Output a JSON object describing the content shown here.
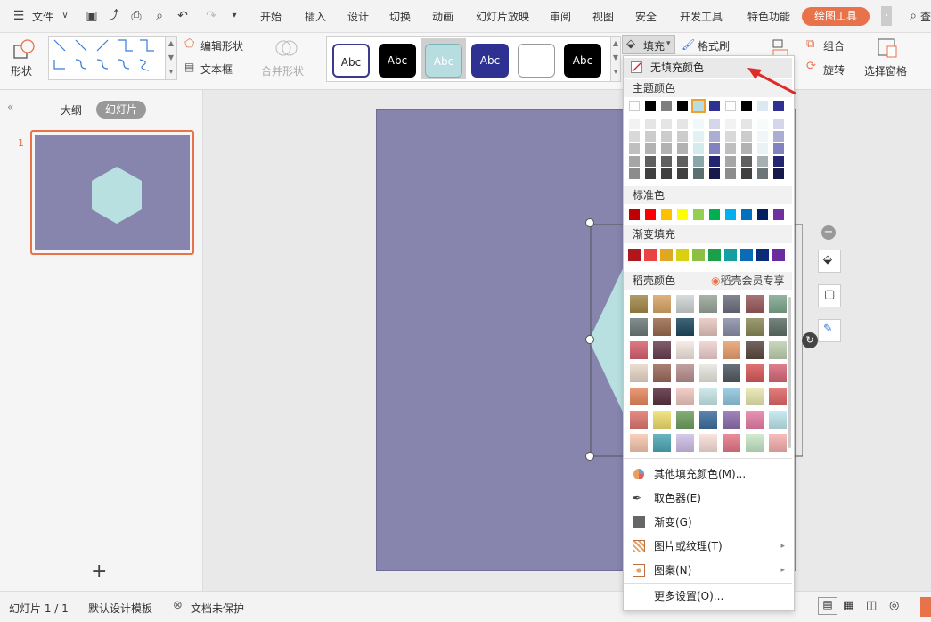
{
  "menu": {
    "file": "文件",
    "tabs": [
      "开始",
      "插入",
      "设计",
      "切换",
      "动画",
      "幻灯片放映",
      "审阅",
      "视图",
      "安全",
      "开发工具",
      "特色功能"
    ],
    "active_tab": "绘图工具",
    "search": "查"
  },
  "ribbon": {
    "shape": "形状",
    "edit_shape": "编辑形状",
    "textbox": "文本框",
    "merge_shape": "合并形状",
    "style_label": "Abc",
    "fill": "填充",
    "format_painter": "格式刷",
    "group": "组合",
    "rotate": "旋转",
    "selection_pane": "选择窗格"
  },
  "left_panel": {
    "outline_tab": "大纲",
    "slides_tab": "幻灯片",
    "slide_number": "1",
    "add": "+"
  },
  "status": {
    "slide_info": "幻灯片 1 / 1",
    "template": "默认设计模板",
    "protection": "文档未保护"
  },
  "fill_menu": {
    "no_fill": "无填充颜色",
    "theme_colors": "主题颜色",
    "standard_colors": "标准色",
    "gradient_fill": "渐变填充",
    "docer_colors": "稻壳颜色",
    "docer_member": "稻壳会员专享",
    "more_colors": "其他填充颜色(M)...",
    "eyedropper": "取色器(E)",
    "gradient": "渐变(G)",
    "picture_texture": "图片或纹理(T)",
    "pattern": "图案(N)",
    "more_settings": "更多设置(O)..."
  },
  "colors": {
    "accent": "#e8734a",
    "slide_bg": "#8784ae",
    "hexagon": "#b8e0e0",
    "theme_top": [
      "#ffffff",
      "#000000",
      "#7f7f7f",
      "#000000",
      "#b7dde0",
      "#2e3192",
      "#ffffff",
      "#000000",
      "#dce9f0",
      "#2e3192"
    ],
    "standard": [
      "#c00000",
      "#ff0000",
      "#ffc000",
      "#ffff00",
      "#92d050",
      "#00b050",
      "#00b0f0",
      "#0070c0",
      "#002060",
      "#7030a0"
    ],
    "gradient": [
      "#b3151e",
      "#e84446",
      "#e0a820",
      "#d8d010",
      "#8cc040",
      "#19a04c",
      "#14a0a0",
      "#0a6cb4",
      "#0a2c78",
      "#6a2aa0"
    ]
  },
  "icons": [
    "menu-icon",
    "save-icon",
    "print-icon",
    "undo-icon",
    "redo-icon",
    "search-icon",
    "fill-icon",
    "eyedropper-icon",
    "rotate-icon"
  ]
}
